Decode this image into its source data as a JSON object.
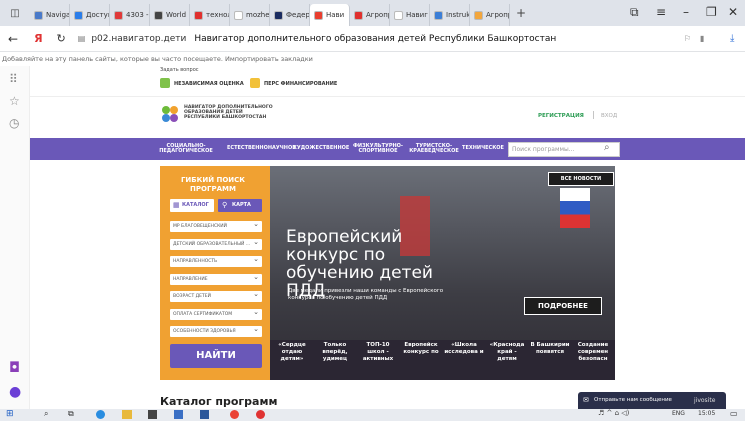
{
  "tabs": [
    {
      "label": "Naviga",
      "color": "#4a7ac9"
    },
    {
      "label": "Доступ",
      "color": "#2b7de9"
    },
    {
      "label": "4303 -",
      "color": "#e03a3a"
    },
    {
      "label": "World",
      "color": "#444"
    },
    {
      "label": "технол",
      "color": "#e0302e"
    },
    {
      "label": "mozhe",
      "color": "#ffffff"
    },
    {
      "label": "Федер",
      "color": "#1b2c60"
    },
    {
      "label": "Нави",
      "color": "#e93e2f",
      "active": true
    },
    {
      "label": "Агропр",
      "color": "#e0302e"
    },
    {
      "label": "Навиг",
      "color": "#ffffff"
    },
    {
      "label": "Instruk",
      "color": "#3c7ed6"
    },
    {
      "label": "Агропр",
      "color": "#f2a63d"
    }
  ],
  "address": {
    "url": "p02.навигатор.дети",
    "title": "Навигатор дополнительного образования детей Республики Башкортостан"
  },
  "bookmarks_text": "Добавляйте на эту панель сайты, которые вы часто посещаете. Импортировать закладки",
  "site": {
    "ask": "Задать вопрос",
    "rating": "НЕЗАВИСИМАЯ ОЦЕНКА",
    "financing": "ПЕРС ФИНАНСИРОВАНИЕ",
    "logo_text": "НАВИГАТОР ДОПОЛНИТЕЛЬНОГО ОБРАЗОВАНИЯ ДЕТЕЙ РЕСПУБЛИКИ БАШКОРТОСТАН",
    "register": "РЕГИСТРАЦИЯ",
    "login": "ВХОД",
    "nav": [
      "СОЦИАЛЬНО-ПЕДАГОГИЧЕСКОЕ",
      "ЕСТЕСТВЕННОНАУЧНОЕ",
      "ХУДОЖЕСТВЕННОЕ",
      "ФИЗКУЛЬТУРНО-СПОРТИВНОЕ",
      "ТУРИСТСКО-КРАЕВЕДЧЕСКОЕ",
      "ТЕХНИЧЕСКОЕ"
    ],
    "search_placeholder": "Поиск программы...",
    "flex_search": "ГИБКИЙ ПОИСК ПРОГРАММ",
    "catalog_btn": "КАТАЛОГ",
    "map_btn": "КАРТА",
    "filters": [
      "МР БЛАГОВЕЩЕНСКИЙ",
      "ДЕТСКИЙ ОБРАЗОВАТЕЛЬНЫЙ ...",
      "НАПРАВЛЕННОСТЬ",
      "НАПРАВЛЕНИЕ",
      "ВОЗРАСТ ДЕТЕЙ",
      "ОПЛАТА СЕРТИФИКАТОМ",
      "ОСОБЕННОСТИ ЗДОРОВЬЯ"
    ],
    "find_btn": "НАЙТИ",
    "all_news": "ВСЕ НОВОСТИ",
    "hero_title": "Европейский конкурс по обучению детей ПДД",
    "hero_sub": "Две медали привезли наши команды с Европейского конкурса по обучению детей ПДД",
    "more_btn": "ПОДРОБНЕЕ",
    "strip": [
      "«Сердце отдаю детям»",
      "Только вперёд, удимец",
      "ТОП-10 школ - активных",
      "Европейск конкурс по",
      "«Школа исследова и",
      "«Краснода край - детям",
      "В Башкирии появятся",
      "Создание современ безопасн"
    ],
    "catalog_title": "Каталог программ",
    "chat": "Отправьте нам сообщение",
    "chat_brand": "jivosite"
  },
  "taskbar": {
    "lang": "ENG",
    "time": "15:05"
  },
  "colors": {
    "nav": "#6a58b8",
    "orange": "#f0a132",
    "accent": "#8a3fb8"
  }
}
